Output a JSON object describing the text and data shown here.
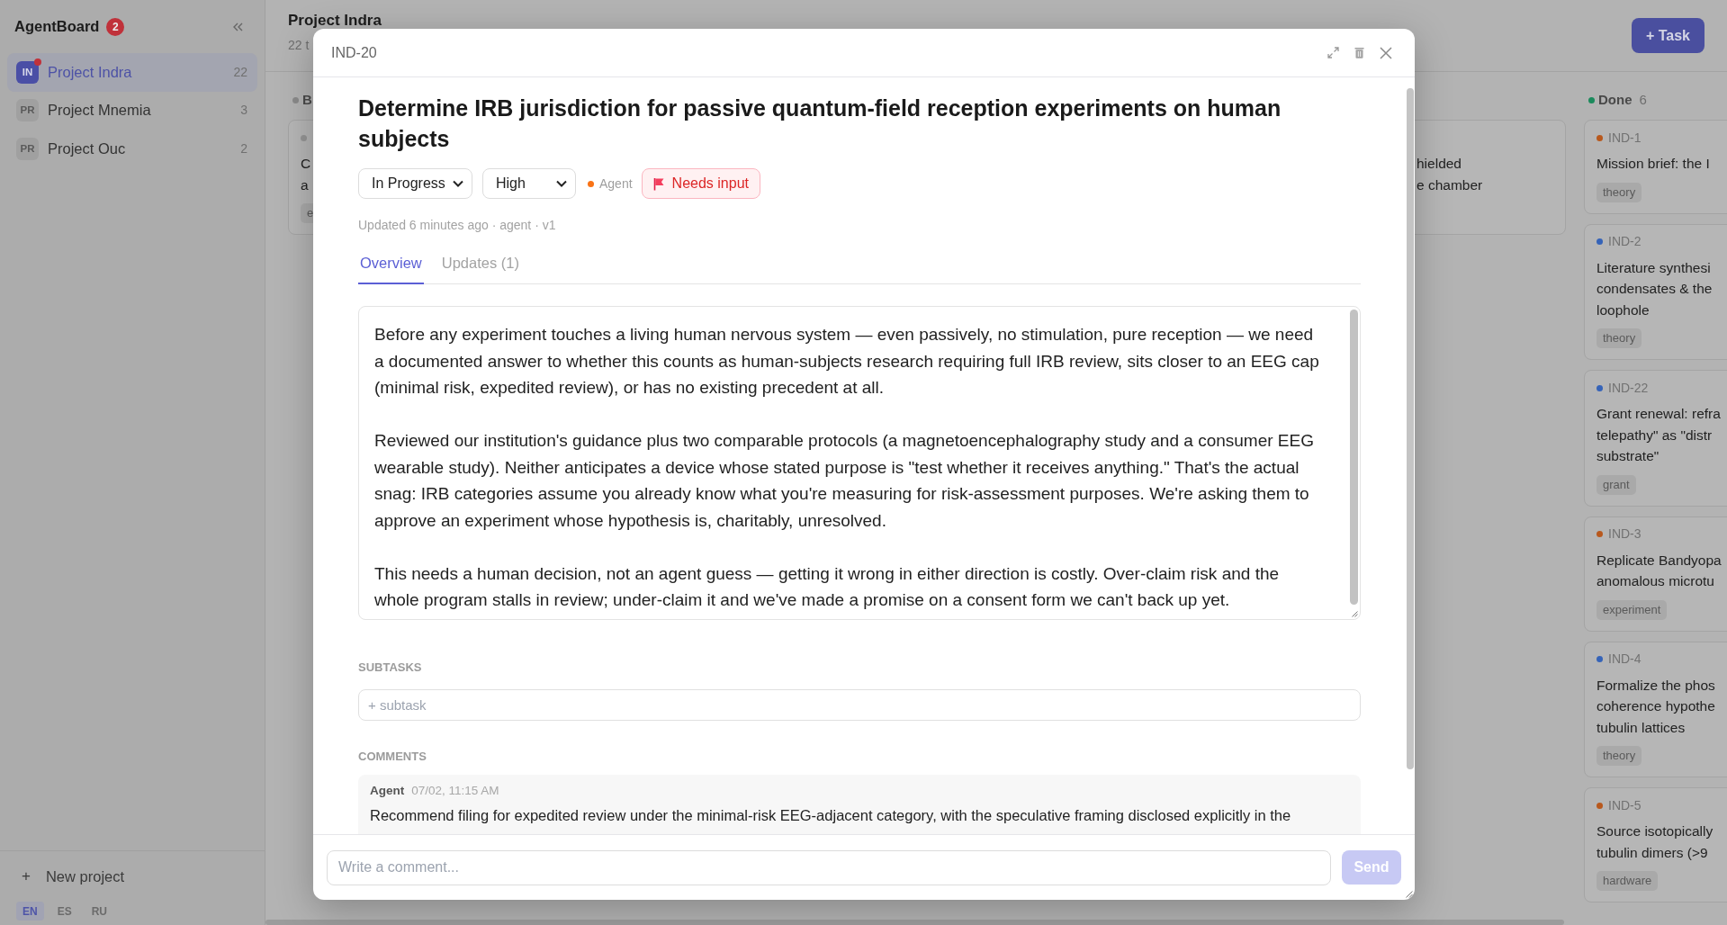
{
  "sidebar": {
    "app_title": "AgentBoard",
    "notification_count": "2",
    "projects": [
      {
        "initials": "IN",
        "name": "Project Indra",
        "count": "22",
        "selected": true,
        "attention": true
      },
      {
        "initials": "PR",
        "name": "Project Mnemia",
        "count": "3",
        "selected": false,
        "attention": false
      },
      {
        "initials": "PR",
        "name": "Project Ouc",
        "count": "2",
        "selected": false,
        "attention": false
      }
    ],
    "new_project": {
      "icon": "+",
      "label": "New project"
    },
    "languages": [
      {
        "code": "EN",
        "selected": true
      },
      {
        "code": "ES",
        "selected": false
      },
      {
        "code": "RU",
        "selected": false
      }
    ]
  },
  "board": {
    "title": "Project Indra",
    "subtitle": "22 t",
    "add_button": "+ Task",
    "columns": [
      {
        "name": "B",
        "color": "#8a8a8a",
        "cards": [
          {
            "color": "#959595",
            "title_lines": [
              "C",
              "a"
            ],
            "tags": [
              "e"
            ]
          }
        ]
      },
      {
        "cards": [
          {
            "title_lines": [
              "hielded",
              "e chamber"
            ]
          }
        ]
      },
      {
        "name": "Done",
        "count": "6",
        "color": "#1b8a5c",
        "cards": [
          {
            "id": "IND-1",
            "color": "#b8581d",
            "title_lines": [
              "Mission brief: the I"
            ],
            "tags": [
              "theory"
            ]
          },
          {
            "id": "IND-2",
            "color": "#3563b8",
            "title_lines": [
              "Literature synthesi",
              "condensates & the",
              "loophole"
            ],
            "tags": [
              "theory"
            ]
          },
          {
            "id": "IND-22",
            "color": "#3563b8",
            "title_lines": [
              "Grant renewal: refra",
              "telepathy\" as \"distr",
              "substrate\""
            ],
            "tags": [
              "grant"
            ]
          },
          {
            "id": "IND-3",
            "color": "#b8581d",
            "title_lines": [
              "Replicate Bandyopa",
              "anomalous microtu"
            ],
            "tags": [
              "experiment"
            ]
          },
          {
            "id": "IND-4",
            "color": "#3563b8",
            "title_lines": [
              "Formalize the phos",
              "coherence hypothe",
              "tubulin lattices"
            ],
            "tags": [
              "theory"
            ]
          },
          {
            "id": "IND-5",
            "color": "#b8581d",
            "title_lines": [
              "Source isotopically",
              "tubulin dimers (>9"
            ],
            "tags": [
              "hardware"
            ]
          }
        ]
      }
    ]
  },
  "task_dialog": {
    "key": "IND-20",
    "title": "Determine IRB jurisdiction for passive quantum-field reception experiments on human subjects",
    "status": "In Progress",
    "priority": "High",
    "assignee": "Agent",
    "flag_button": "Needs input",
    "meta": "Updated 6 minutes ago · agent · v1",
    "tabs": [
      {
        "label": "Overview",
        "selected": true
      },
      {
        "label": "Updates (1)",
        "selected": false
      }
    ],
    "description": [
      "Before any experiment touches a living human nervous system — even passively, no stimulation, pure reception — we need a documented answer to whether this counts as human-subjects research requiring full IRB review, sits closer to an EEG cap (minimal risk, expedited review), or has no existing precedent at all.",
      "Reviewed our institution's guidance plus two comparable protocols (a magnetoencephalography study and a consumer EEG wearable study). Neither anticipates a device whose stated purpose is \"test whether it receives anything.\" That's the actual snag: IRB categories assume you already know what you're measuring for risk-assessment purposes. We're asking them to approve an experiment whose hypothesis is, charitably, unresolved.",
      "This needs a human decision, not an agent guess — getting it wrong in either direction is costly. Over-claim risk and the whole program stalls in review; under-claim it and we've made a promise on a consent form we can't back up yet."
    ],
    "subtasks": {
      "label": "SUBTASKS",
      "placeholder": "+ subtask"
    },
    "comments": {
      "label": "COMMENTS",
      "items": [
        {
          "author": "Agent",
          "time": "07/02, 11:15 AM",
          "text": "Recommend filing for expedited review under the minimal-risk EEG-adjacent category, with the speculative framing disclosed explicitly in the"
        }
      ]
    },
    "comment_box": {
      "placeholder": "Write a comment...",
      "send_label": "Send",
      "send_disabled": true
    }
  }
}
